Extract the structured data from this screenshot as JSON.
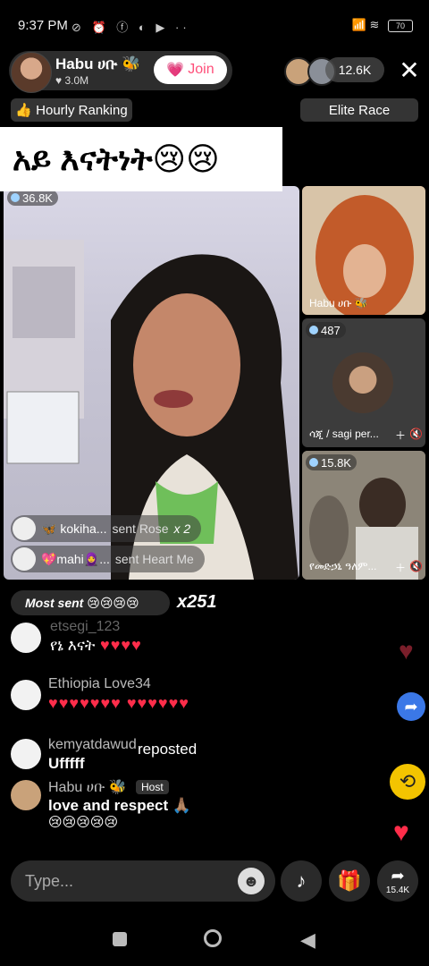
{
  "status_bar": {
    "time": "9:37 PM",
    "icons_left": "⊘ ⏰ ⓕ ◐ ▶ ··",
    "battery": "70"
  },
  "host": {
    "name": "Habu ሀቡ 🐝",
    "likes": "♥ 3.0M",
    "join_label": "Join"
  },
  "viewers": {
    "count": "12.6K"
  },
  "chips": {
    "hourly_ranking": "👍 Hourly Ranking",
    "elite_race": "Elite Race"
  },
  "caption": {
    "text": "አይ  እናትነት😢😢"
  },
  "main_video": {
    "viewer_badge": "36.8K"
  },
  "gift_messages": [
    {
      "user": "🦋 kokiha...",
      "action": "sent Rose",
      "count": "x 2"
    },
    {
      "user": "💖mahi🧕...",
      "action": "sent Heart Me",
      "count": ""
    }
  ],
  "side_tiles": [
    {
      "label": "Habu ሀቡ 🐝",
      "badge": ""
    },
    {
      "label": "ሳጂ / sagi per...",
      "badge": "487"
    },
    {
      "label": "የመድኃኒ ዓለም...",
      "badge": "15.8K"
    }
  ],
  "most_sent": {
    "label": "Most sent 😢😢😢😢",
    "count": "x251"
  },
  "chat": [
    {
      "name": "etsegi_123",
      "text": "የኔ እናት",
      "hearts": "♥♥♥♥"
    },
    {
      "name": "Ethiopia Love34",
      "text": "",
      "hearts": "♥♥♥♥♥♥♥    ♥♥♥♥♥♥"
    },
    {
      "name": "kemyatdawud",
      "text": "Ufffff",
      "extra": "reposted"
    },
    {
      "name": "Habu ሀቡ 🐝",
      "role": "Host",
      "text": "love and respect 🙏🏽",
      "emoji": "😢😢😢😢😢"
    }
  ],
  "input": {
    "placeholder": "Type..."
  },
  "share": {
    "count": "15.4K"
  },
  "colors": {
    "accent_pink": "#ff4f7a",
    "heart_red": "#ff2d4a",
    "repost_yellow": "#f3c400",
    "share_blue": "#3b78e7"
  }
}
